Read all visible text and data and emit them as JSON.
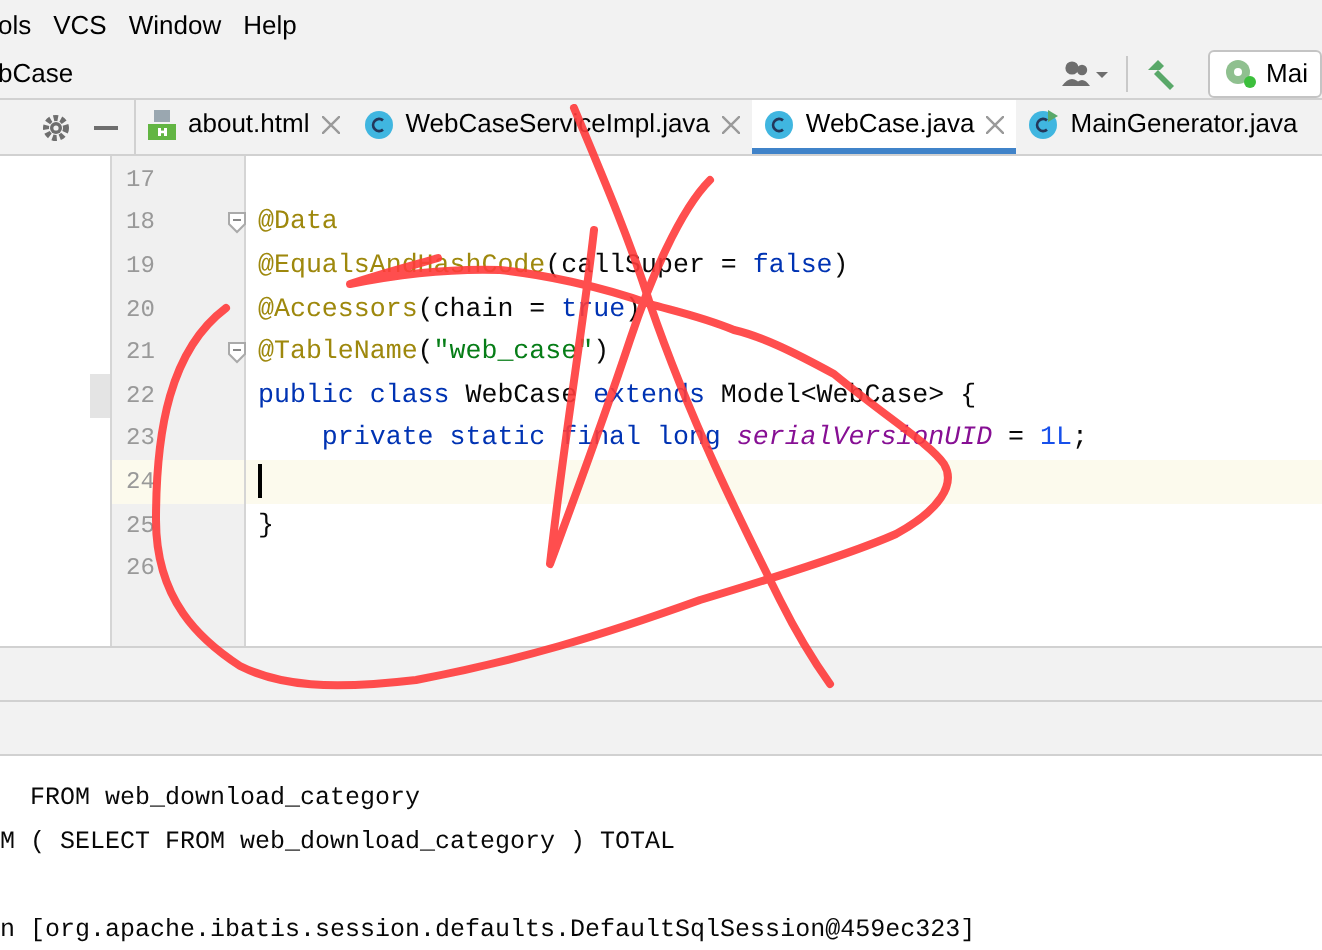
{
  "menu": [
    "ols",
    "VCS",
    "Window",
    "Help"
  ],
  "nav": {
    "breadcrumb": "bCase",
    "run_config": "Mai"
  },
  "tabs": [
    {
      "label": "about.html",
      "kind": "html",
      "selected": false,
      "closable": true
    },
    {
      "label": "WebCaseServiceImpl.java",
      "kind": "class",
      "selected": false,
      "closable": true
    },
    {
      "label": "WebCase.java",
      "kind": "class",
      "selected": true,
      "closable": true
    },
    {
      "label": "MainGenerator.java",
      "kind": "main",
      "selected": false,
      "closable": false
    }
  ],
  "editor": {
    "lines": [
      {
        "number": "17",
        "current": false,
        "fold": false,
        "marked": false
      },
      {
        "number": "18",
        "current": false,
        "fold": true,
        "marked": false,
        "tokens": [
          {
            "text": "@Data",
            "kind": "annotation"
          }
        ]
      },
      {
        "number": "19",
        "current": false,
        "fold": false,
        "marked": false,
        "tokens": [
          {
            "text": "@EqualsAndHashCode",
            "kind": "annotation"
          },
          {
            "text": "(callSuper = ",
            "kind": "plain"
          },
          {
            "text": "false",
            "kind": "keyword"
          },
          {
            "text": ")",
            "kind": "plain"
          }
        ]
      },
      {
        "number": "20",
        "current": false,
        "fold": false,
        "marked": false,
        "tokens": [
          {
            "text": "@Accessors",
            "kind": "annotation"
          },
          {
            "text": "(chain = ",
            "kind": "plain"
          },
          {
            "text": "true",
            "kind": "keyword"
          },
          {
            "text": ")",
            "kind": "plain"
          }
        ]
      },
      {
        "number": "21",
        "current": false,
        "fold": true,
        "marked": false,
        "tokens": [
          {
            "text": "@TableName",
            "kind": "annotation"
          },
          {
            "text": "(",
            "kind": "plain"
          },
          {
            "text": "\"web_case\"",
            "kind": "string"
          },
          {
            "text": ")",
            "kind": "plain"
          }
        ]
      },
      {
        "number": "22",
        "current": false,
        "fold": false,
        "marked": true,
        "tokens": [
          {
            "text": "public class ",
            "kind": "keyword"
          },
          {
            "text": "WebCase ",
            "kind": "plain"
          },
          {
            "text": "extends ",
            "kind": "keyword"
          },
          {
            "text": "Model<WebCase> {",
            "kind": "plain"
          }
        ]
      },
      {
        "number": "23",
        "current": false,
        "fold": false,
        "marked": false,
        "tokens": [
          {
            "text": "    private static final long ",
            "kind": "keyword"
          },
          {
            "text": "serialVersionUID",
            "kind": "field"
          },
          {
            "text": " = ",
            "kind": "plain"
          },
          {
            "text": "1L",
            "kind": "number"
          },
          {
            "text": ";",
            "kind": "plain"
          }
        ]
      },
      {
        "number": "24",
        "current": true,
        "fold": false,
        "marked": false
      },
      {
        "number": "25",
        "current": false,
        "fold": false,
        "marked": false,
        "tokens": [
          {
            "text": "}",
            "kind": "plain"
          }
        ]
      },
      {
        "number": "26",
        "current": false,
        "fold": false,
        "marked": false
      }
    ]
  },
  "console": {
    "lines": [
      {
        "kind": "text",
        "text": "  FROM web_download_category"
      },
      {
        "kind": "text",
        "text": "M ( SELECT FROM web_download_category ) TOTAL"
      },
      {
        "kind": "blank"
      },
      {
        "kind": "text",
        "text": "n [org.apache.ibatis.session.defaults.DefaultSqlSession@459ec323]"
      }
    ]
  }
}
